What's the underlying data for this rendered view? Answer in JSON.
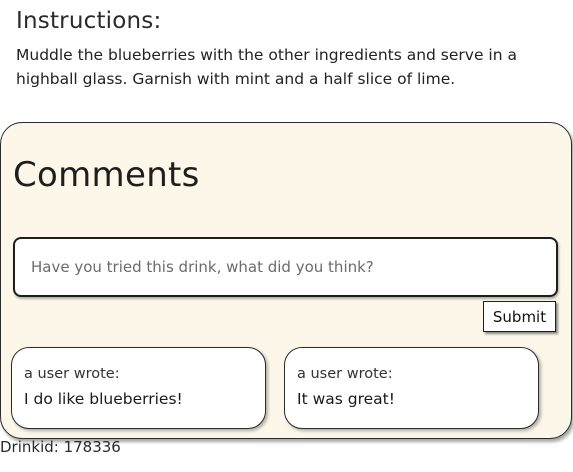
{
  "instructions": {
    "heading": "Instructions:",
    "text": "Muddle the blueberries with the other ingredients and serve in a highball glass. Garnish with mint and a half slice of lime."
  },
  "comments": {
    "heading": "Comments",
    "input_placeholder": "Have you tried this drink, what did you think?",
    "input_value": "",
    "submit_label": "Submit",
    "items": [
      {
        "author": "a user wrote:",
        "body": "I do like blueberries!"
      },
      {
        "author": "a user wrote:",
        "body": "It was great!"
      }
    ]
  },
  "footer": {
    "drink_id": "Drinkid: 178336"
  },
  "colors": {
    "panel_background": "#fcf7e9",
    "border": "#2b2b2b"
  }
}
